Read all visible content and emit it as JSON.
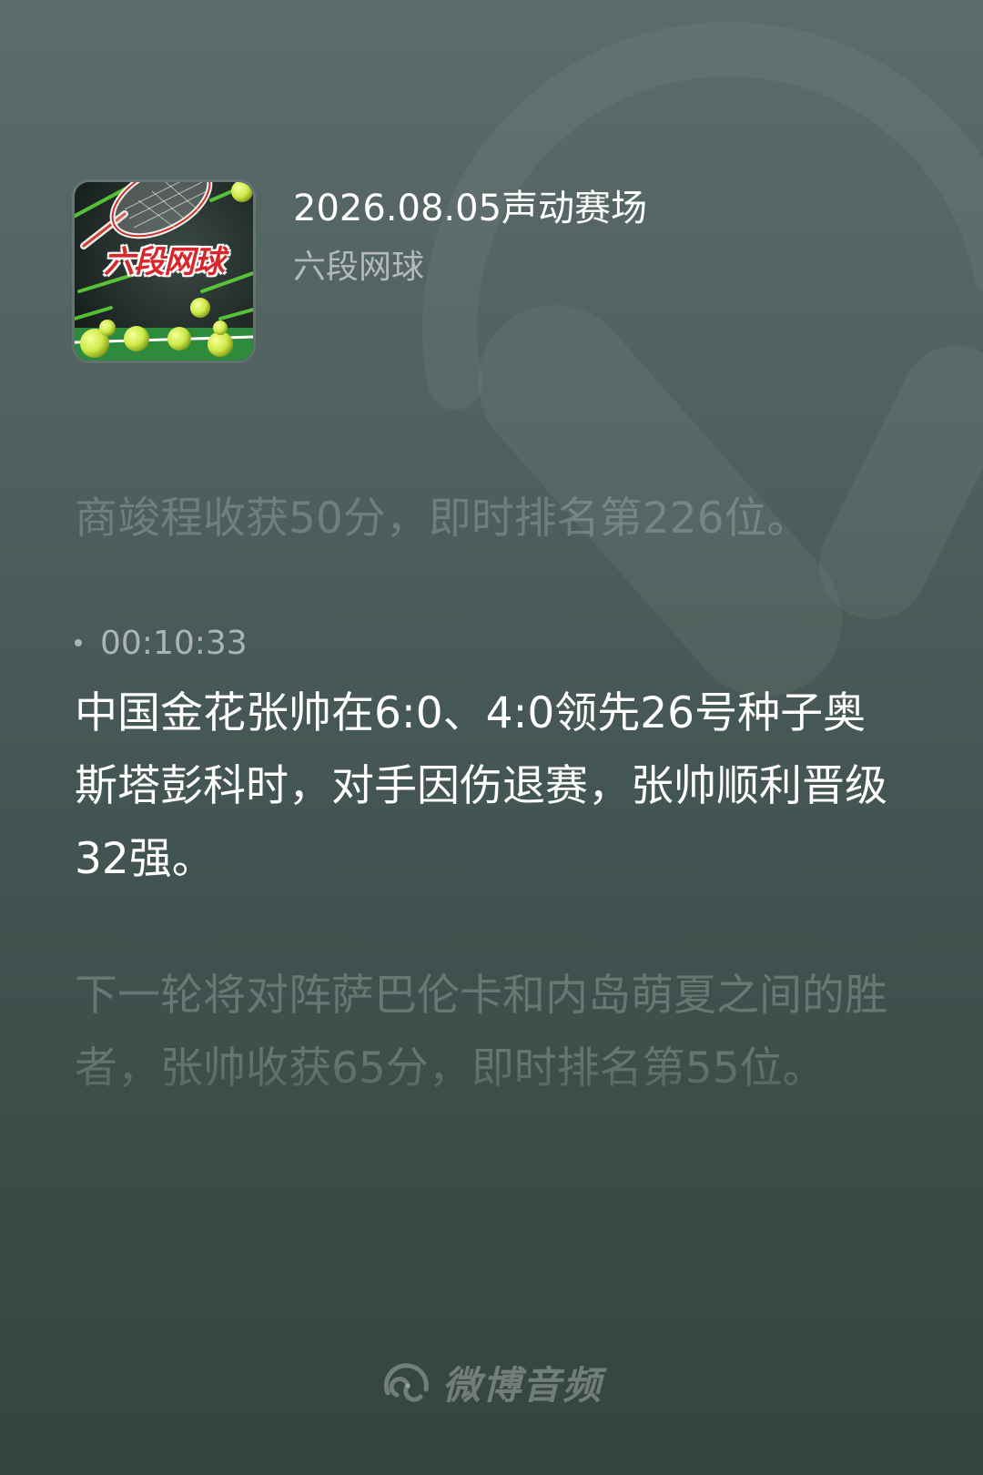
{
  "episode": {
    "title": "2026.08.05声动赛场",
    "podcast_name": "六段网球",
    "cover_title": "六段网球",
    "cover_icon": "tennis-cover-art"
  },
  "transcript": {
    "previous_paragraph": "商竣程收获50分，即时排名第226位。",
    "current": {
      "timestamp": "00:10:33",
      "paragraph": "中国金花张帅在6:0、4:0领先26号种子奥斯塔彭科时，对手因伤退赛，张帅顺利晋级32强。"
    },
    "next_paragraph": "下一轮将对阵萨巴伦卡和内岛萌夏之间的胜者，张帅收获65分，即时排名第55位。"
  },
  "footer": {
    "brand": "微博音频",
    "brand_icon": "weibo-audio-logo-icon"
  },
  "colors": {
    "background_top": "#5b6c6a",
    "background_bottom": "#34443f",
    "cover_title_red": "#d8262a"
  }
}
